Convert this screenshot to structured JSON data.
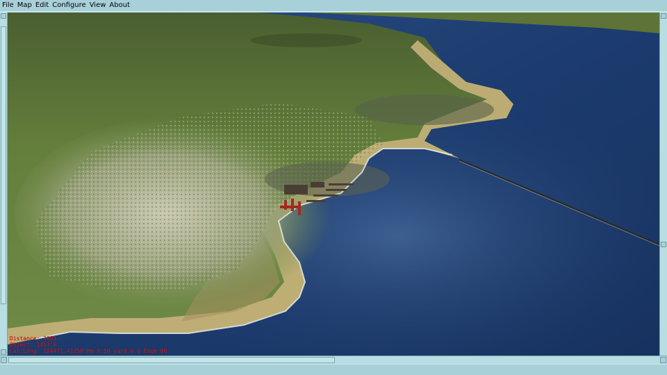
{
  "menubar": {
    "items": [
      "File",
      "Map",
      "Edit",
      "Configure",
      "View",
      "About"
    ]
  },
  "overlay": {
    "line1": "Distance: 3681",
    "line2": "Object: 1457:0",
    "line3": "Lat/Long: 104471.41250 Hm 0.50 yard 0.6 Edge 00"
  },
  "colors": {
    "frame": "#a8d0d8",
    "water_deep": "#1e3a6a",
    "land": "#5d7a3a",
    "overlay_text": "#e01818"
  }
}
